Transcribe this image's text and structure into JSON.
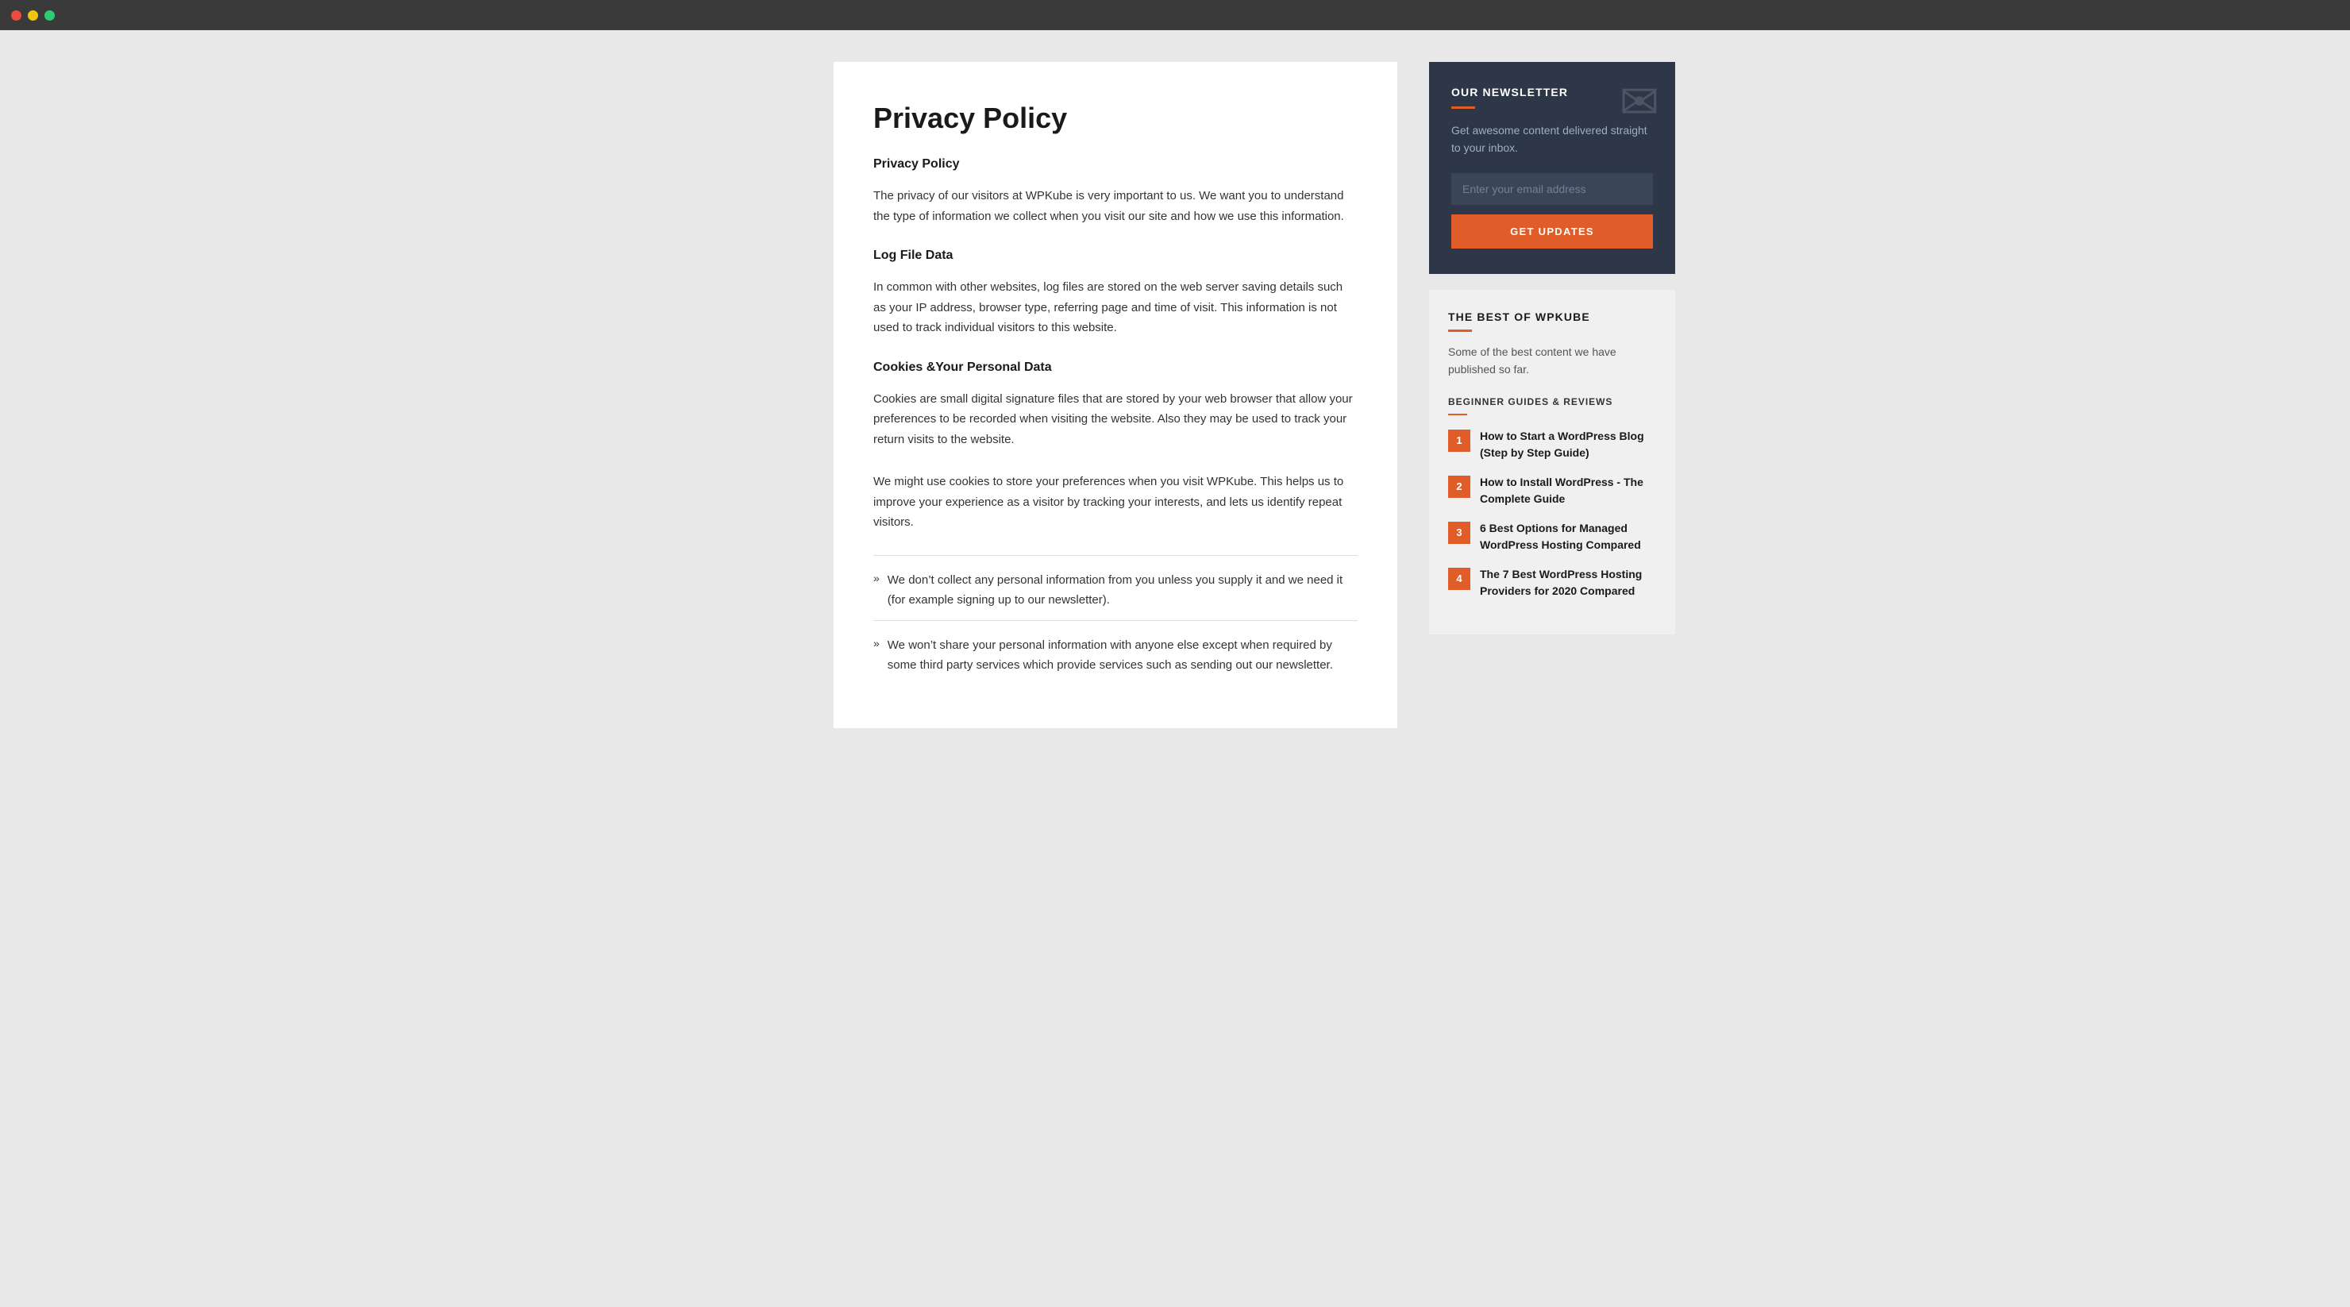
{
  "titlebar": {
    "dots": [
      "red",
      "yellow",
      "green"
    ]
  },
  "main": {
    "page_title": "Privacy Policy",
    "section1_heading": "Privacy Policy",
    "section1_body": "The privacy of our visitors at WPKube is very important to us. We want you to understand the type of information we collect when you visit our site and how we use this information.",
    "section2_heading": "Log File Data",
    "section2_body": "In common with other websites, log files are stored on the web server saving details such as your IP address, browser type, referring page and time of visit. This information is not used to track individual visitors to this website.",
    "section3_heading": "Cookies &Your Personal Data",
    "section3_body": "Cookies are small digital signature files that are stored by your web browser that allow your preferences to be recorded when visiting the website. Also they may be used to track your return visits to the website.",
    "section3_body2": "We might use cookies to store your preferences when you visit WPKube. This helps us to improve your experience as a visitor by tracking your interests, and lets us identify repeat visitors.",
    "list_items": [
      "We don’t collect any personal information from you unless you supply it and we need it (for example signing up to our newsletter).",
      "We won’t share your personal information with anyone else except when required by some third party services which provide services such as sending out our newsletter."
    ]
  },
  "newsletter": {
    "title": "OUR NEWSLETTER",
    "description": "Get awesome content delivered straight to your inbox.",
    "email_placeholder": "Enter your email address",
    "button_label": "GET UPDATES"
  },
  "bestof": {
    "title": "THE BEST OF WPKUBE",
    "description": "Some of the best content we have published so far.",
    "section_label": "BEGINNER GUIDES & REVIEWS",
    "articles": [
      {
        "number": "1",
        "title": "How to Start a WordPress Blog (Step by Step Guide)"
      },
      {
        "number": "2",
        "title": "How to Install WordPress - The Complete Guide"
      },
      {
        "number": "3",
        "title": "6 Best Options for Managed WordPress Hosting Compared"
      },
      {
        "number": "4",
        "title": "The 7 Best WordPress Hosting Providers for 2020 Compared"
      }
    ]
  }
}
